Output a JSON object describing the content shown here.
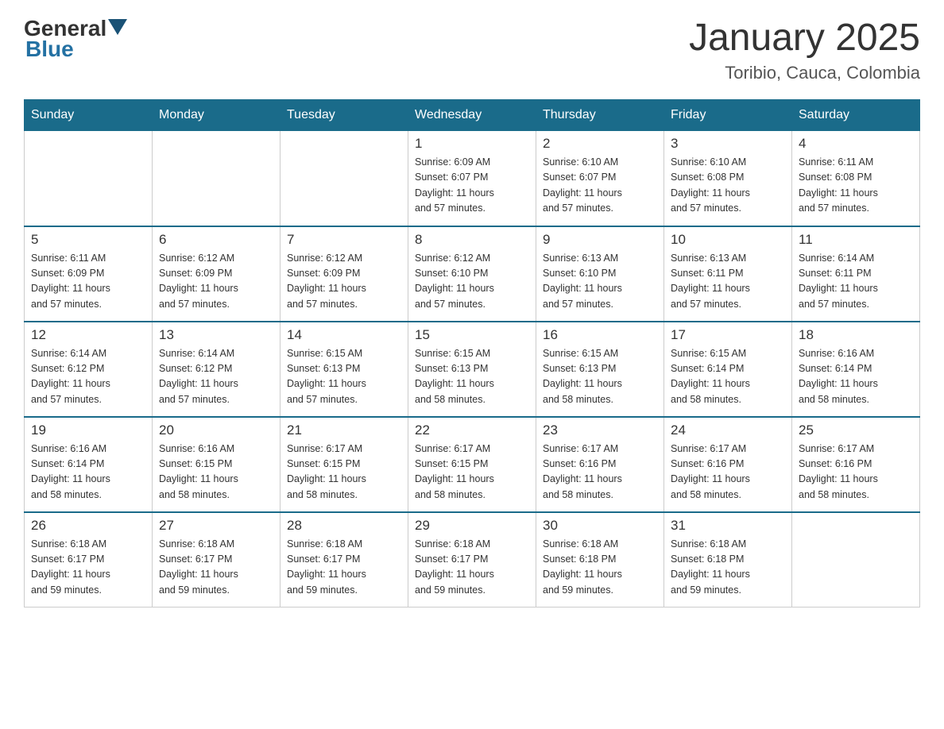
{
  "header": {
    "logo": {
      "general": "General",
      "blue": "Blue"
    },
    "title": "January 2025",
    "location": "Toribio, Cauca, Colombia"
  },
  "days_of_week": [
    "Sunday",
    "Monday",
    "Tuesday",
    "Wednesday",
    "Thursday",
    "Friday",
    "Saturday"
  ],
  "weeks": [
    {
      "days": [
        {
          "number": "",
          "info": ""
        },
        {
          "number": "",
          "info": ""
        },
        {
          "number": "",
          "info": ""
        },
        {
          "number": "1",
          "info": "Sunrise: 6:09 AM\nSunset: 6:07 PM\nDaylight: 11 hours\nand 57 minutes."
        },
        {
          "number": "2",
          "info": "Sunrise: 6:10 AM\nSunset: 6:07 PM\nDaylight: 11 hours\nand 57 minutes."
        },
        {
          "number": "3",
          "info": "Sunrise: 6:10 AM\nSunset: 6:08 PM\nDaylight: 11 hours\nand 57 minutes."
        },
        {
          "number": "4",
          "info": "Sunrise: 6:11 AM\nSunset: 6:08 PM\nDaylight: 11 hours\nand 57 minutes."
        }
      ]
    },
    {
      "days": [
        {
          "number": "5",
          "info": "Sunrise: 6:11 AM\nSunset: 6:09 PM\nDaylight: 11 hours\nand 57 minutes."
        },
        {
          "number": "6",
          "info": "Sunrise: 6:12 AM\nSunset: 6:09 PM\nDaylight: 11 hours\nand 57 minutes."
        },
        {
          "number": "7",
          "info": "Sunrise: 6:12 AM\nSunset: 6:09 PM\nDaylight: 11 hours\nand 57 minutes."
        },
        {
          "number": "8",
          "info": "Sunrise: 6:12 AM\nSunset: 6:10 PM\nDaylight: 11 hours\nand 57 minutes."
        },
        {
          "number": "9",
          "info": "Sunrise: 6:13 AM\nSunset: 6:10 PM\nDaylight: 11 hours\nand 57 minutes."
        },
        {
          "number": "10",
          "info": "Sunrise: 6:13 AM\nSunset: 6:11 PM\nDaylight: 11 hours\nand 57 minutes."
        },
        {
          "number": "11",
          "info": "Sunrise: 6:14 AM\nSunset: 6:11 PM\nDaylight: 11 hours\nand 57 minutes."
        }
      ]
    },
    {
      "days": [
        {
          "number": "12",
          "info": "Sunrise: 6:14 AM\nSunset: 6:12 PM\nDaylight: 11 hours\nand 57 minutes."
        },
        {
          "number": "13",
          "info": "Sunrise: 6:14 AM\nSunset: 6:12 PM\nDaylight: 11 hours\nand 57 minutes."
        },
        {
          "number": "14",
          "info": "Sunrise: 6:15 AM\nSunset: 6:13 PM\nDaylight: 11 hours\nand 57 minutes."
        },
        {
          "number": "15",
          "info": "Sunrise: 6:15 AM\nSunset: 6:13 PM\nDaylight: 11 hours\nand 58 minutes."
        },
        {
          "number": "16",
          "info": "Sunrise: 6:15 AM\nSunset: 6:13 PM\nDaylight: 11 hours\nand 58 minutes."
        },
        {
          "number": "17",
          "info": "Sunrise: 6:15 AM\nSunset: 6:14 PM\nDaylight: 11 hours\nand 58 minutes."
        },
        {
          "number": "18",
          "info": "Sunrise: 6:16 AM\nSunset: 6:14 PM\nDaylight: 11 hours\nand 58 minutes."
        }
      ]
    },
    {
      "days": [
        {
          "number": "19",
          "info": "Sunrise: 6:16 AM\nSunset: 6:14 PM\nDaylight: 11 hours\nand 58 minutes."
        },
        {
          "number": "20",
          "info": "Sunrise: 6:16 AM\nSunset: 6:15 PM\nDaylight: 11 hours\nand 58 minutes."
        },
        {
          "number": "21",
          "info": "Sunrise: 6:17 AM\nSunset: 6:15 PM\nDaylight: 11 hours\nand 58 minutes."
        },
        {
          "number": "22",
          "info": "Sunrise: 6:17 AM\nSunset: 6:15 PM\nDaylight: 11 hours\nand 58 minutes."
        },
        {
          "number": "23",
          "info": "Sunrise: 6:17 AM\nSunset: 6:16 PM\nDaylight: 11 hours\nand 58 minutes."
        },
        {
          "number": "24",
          "info": "Sunrise: 6:17 AM\nSunset: 6:16 PM\nDaylight: 11 hours\nand 58 minutes."
        },
        {
          "number": "25",
          "info": "Sunrise: 6:17 AM\nSunset: 6:16 PM\nDaylight: 11 hours\nand 58 minutes."
        }
      ]
    },
    {
      "days": [
        {
          "number": "26",
          "info": "Sunrise: 6:18 AM\nSunset: 6:17 PM\nDaylight: 11 hours\nand 59 minutes."
        },
        {
          "number": "27",
          "info": "Sunrise: 6:18 AM\nSunset: 6:17 PM\nDaylight: 11 hours\nand 59 minutes."
        },
        {
          "number": "28",
          "info": "Sunrise: 6:18 AM\nSunset: 6:17 PM\nDaylight: 11 hours\nand 59 minutes."
        },
        {
          "number": "29",
          "info": "Sunrise: 6:18 AM\nSunset: 6:17 PM\nDaylight: 11 hours\nand 59 minutes."
        },
        {
          "number": "30",
          "info": "Sunrise: 6:18 AM\nSunset: 6:18 PM\nDaylight: 11 hours\nand 59 minutes."
        },
        {
          "number": "31",
          "info": "Sunrise: 6:18 AM\nSunset: 6:18 PM\nDaylight: 11 hours\nand 59 minutes."
        },
        {
          "number": "",
          "info": ""
        }
      ]
    }
  ]
}
